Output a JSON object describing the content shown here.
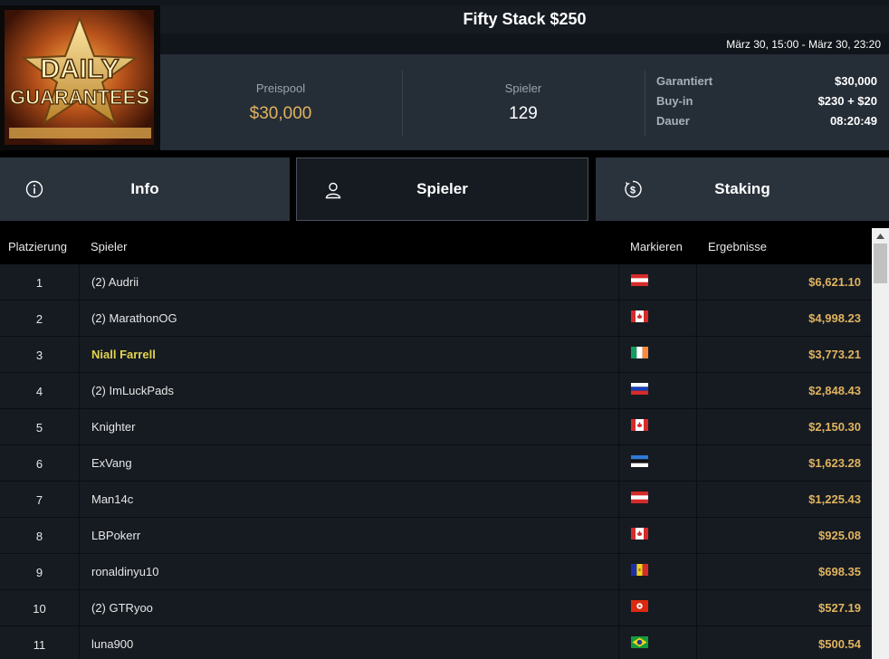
{
  "header": {
    "title": "Fifty Stack $250",
    "date_range": "März 30, 15:00 - März 30, 23:20",
    "logo": {
      "line1": "DAILY",
      "line2": "GUARANTEES"
    }
  },
  "stats": {
    "prize_pool_label": "Preispool",
    "prize_pool_value": "$30,000",
    "players_label": "Spieler",
    "players_value": "129"
  },
  "details": {
    "guaranteed_label": "Garantiert",
    "guaranteed_value": "$30,000",
    "buyin_label": "Buy-in",
    "buyin_value": "$230 + $20",
    "duration_label": "Dauer",
    "duration_value": "08:20:49"
  },
  "tabs": [
    {
      "label": "Info",
      "icon": "info-icon"
    },
    {
      "label": "Spieler",
      "icon": "user-icon"
    },
    {
      "label": "Staking",
      "icon": "dollar-coin-icon"
    }
  ],
  "table": {
    "columns": [
      "Platzierung",
      "Spieler",
      "Markieren",
      "Ergebnisse"
    ],
    "rows": [
      {
        "place": "1",
        "player": "(2) Audrii",
        "flag": "austria",
        "result": "$6,621.10"
      },
      {
        "place": "2",
        "player": "(2) MarathonOG",
        "flag": "canada",
        "result": "$4,998.23"
      },
      {
        "place": "3",
        "player": "Niall Farrell",
        "flag": "ireland",
        "result": "$3,773.21"
      },
      {
        "place": "4",
        "player": "(2) ImLuckPads",
        "flag": "russia",
        "result": "$2,848.43"
      },
      {
        "place": "5",
        "player": "Knighter",
        "flag": "canada",
        "result": "$2,150.30"
      },
      {
        "place": "6",
        "player": "ExVang",
        "flag": "estonia",
        "result": "$1,623.28"
      },
      {
        "place": "7",
        "player": "Man14c",
        "flag": "austria",
        "result": "$1,225.43"
      },
      {
        "place": "8",
        "player": "LBPokerr",
        "flag": "canada",
        "result": "$925.08"
      },
      {
        "place": "9",
        "player": "ronaldinyu10",
        "flag": "andorra",
        "result": "$698.35"
      },
      {
        "place": "10",
        "player": "(2) GTRyoo",
        "flag": "hong-kong",
        "result": "$527.19"
      },
      {
        "place": "11",
        "player": "luna900",
        "flag": "brazil",
        "result": "$500.54"
      }
    ]
  },
  "colors": {
    "gold": "#e0b35e",
    "highlight_player": "#e4d34f"
  }
}
